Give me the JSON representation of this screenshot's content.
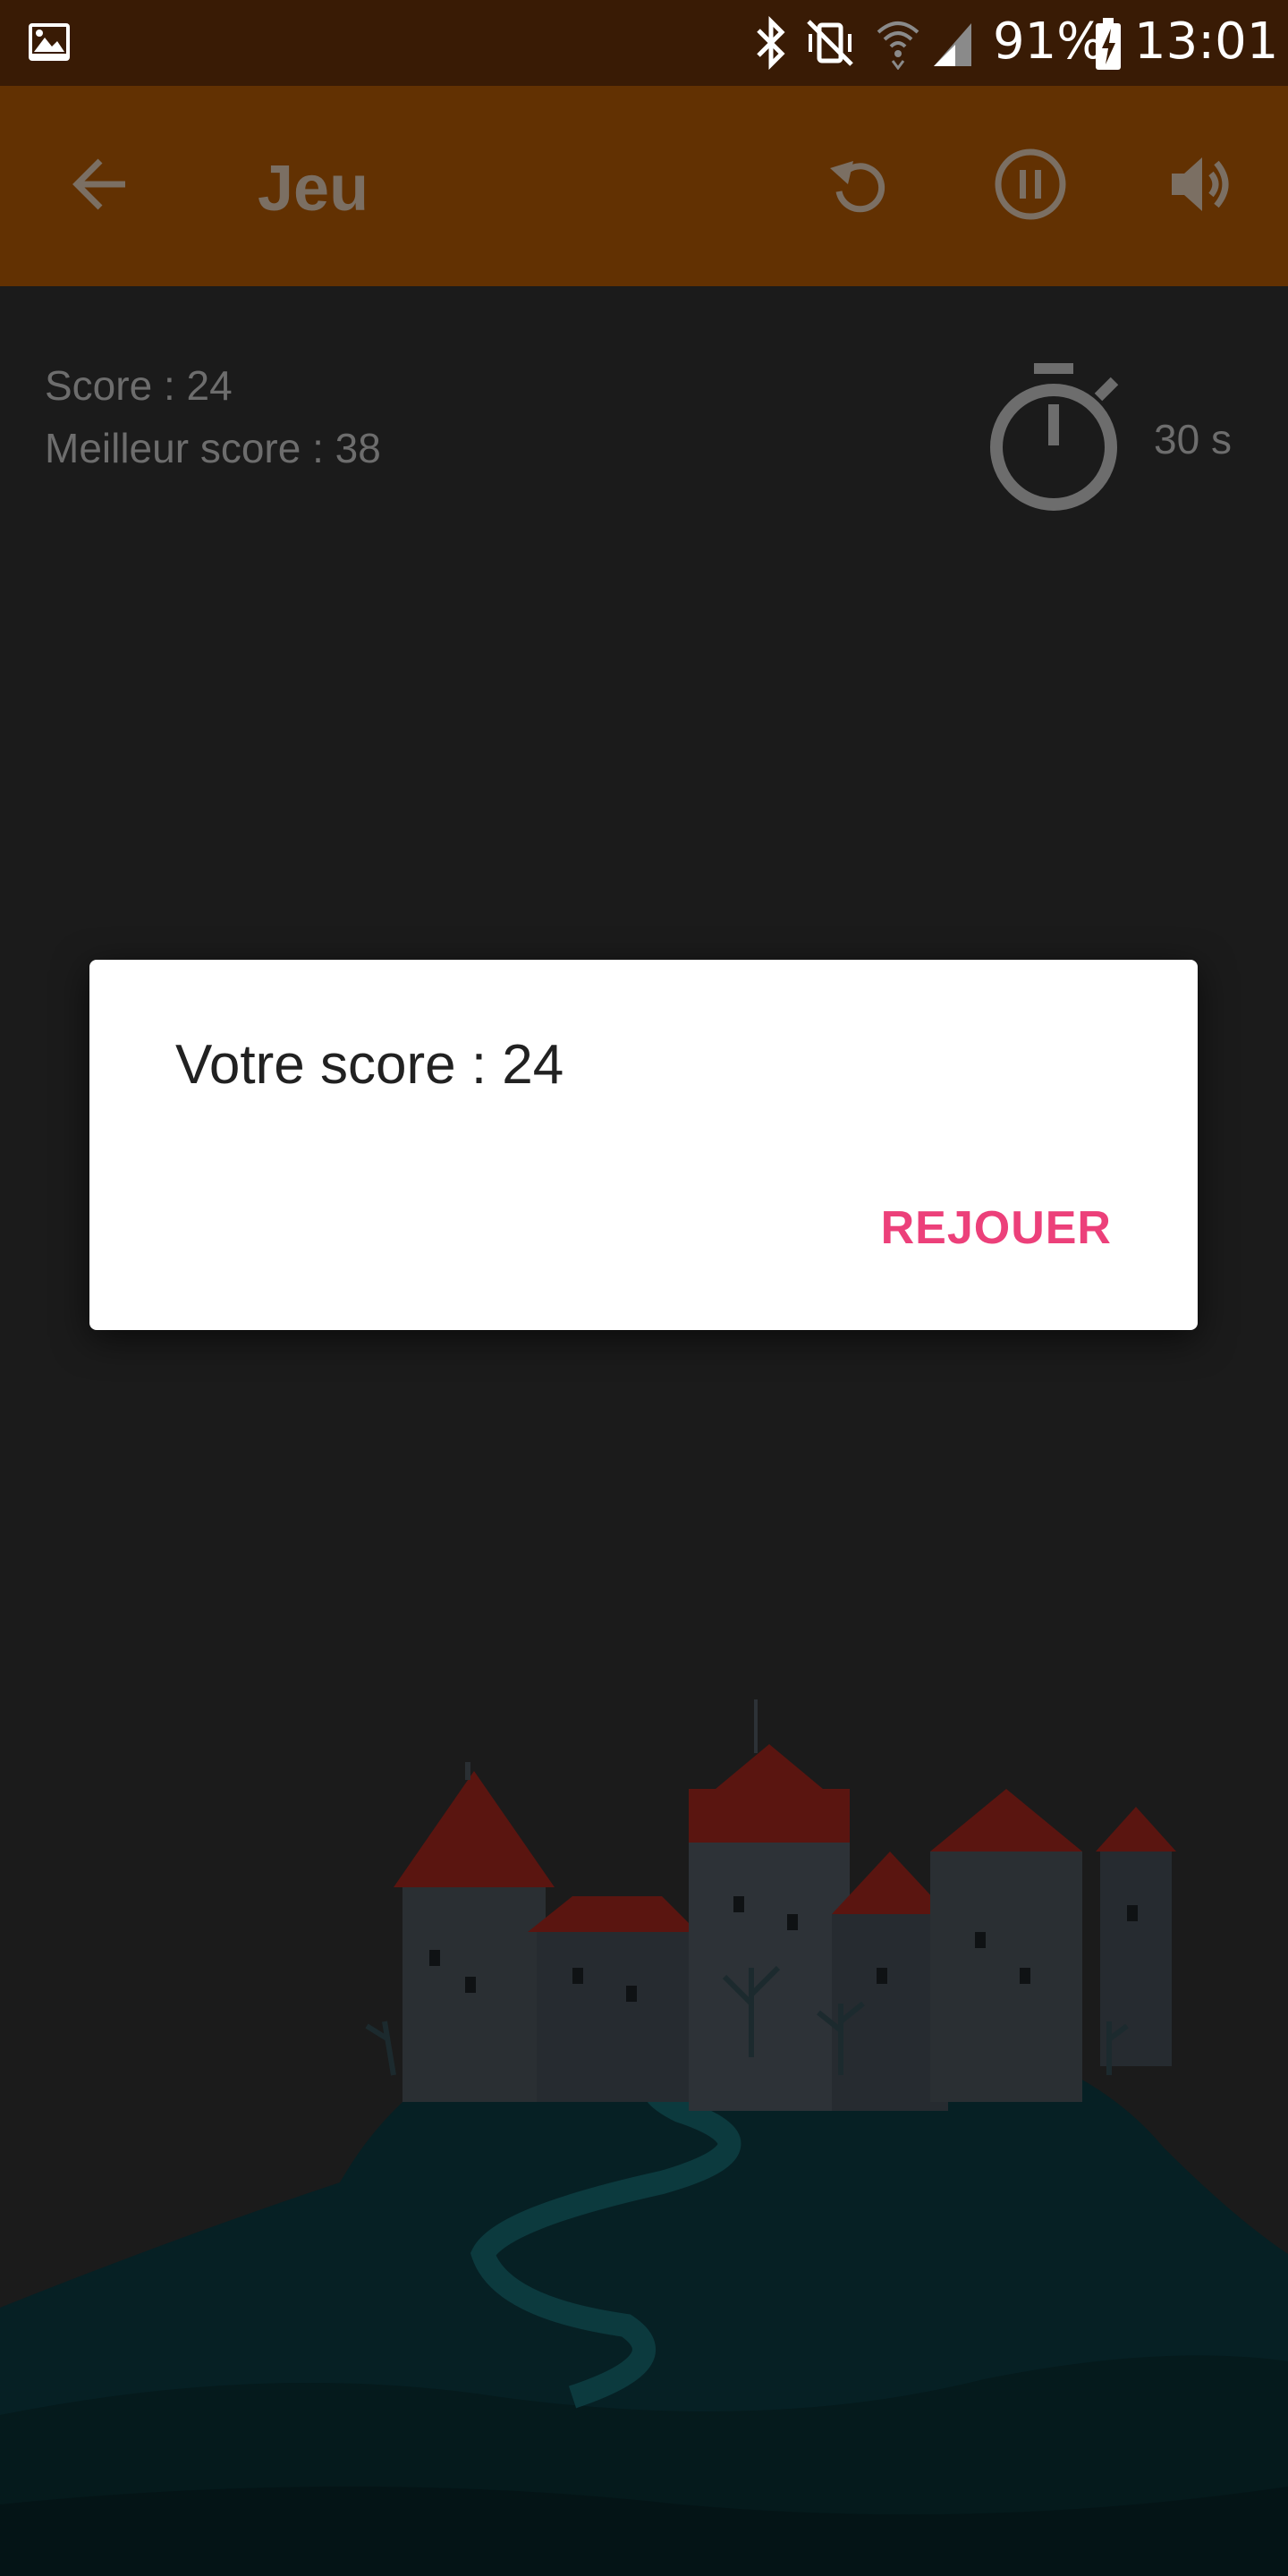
{
  "status_bar": {
    "battery": "91%",
    "time": "13:01",
    "icons": [
      "image-icon",
      "bluetooth-icon",
      "mute-vibrate-icon",
      "wifi-icon",
      "signal-icon",
      "battery-charging-icon"
    ]
  },
  "toolbar": {
    "title": "Jeu",
    "icons": [
      "back-arrow-icon",
      "replay-icon",
      "pause-icon",
      "volume-icon"
    ]
  },
  "game": {
    "score_label": "Score : 24",
    "best_score_label": "Meilleur score : 38",
    "timer_value": "30 s"
  },
  "dialog": {
    "message": "Votre score : 24",
    "button_label": "REJOUER"
  },
  "colors": {
    "status_bar": "#391b05",
    "toolbar": "#623102",
    "background": "#1b1b1b",
    "accent": "#ec407a"
  }
}
